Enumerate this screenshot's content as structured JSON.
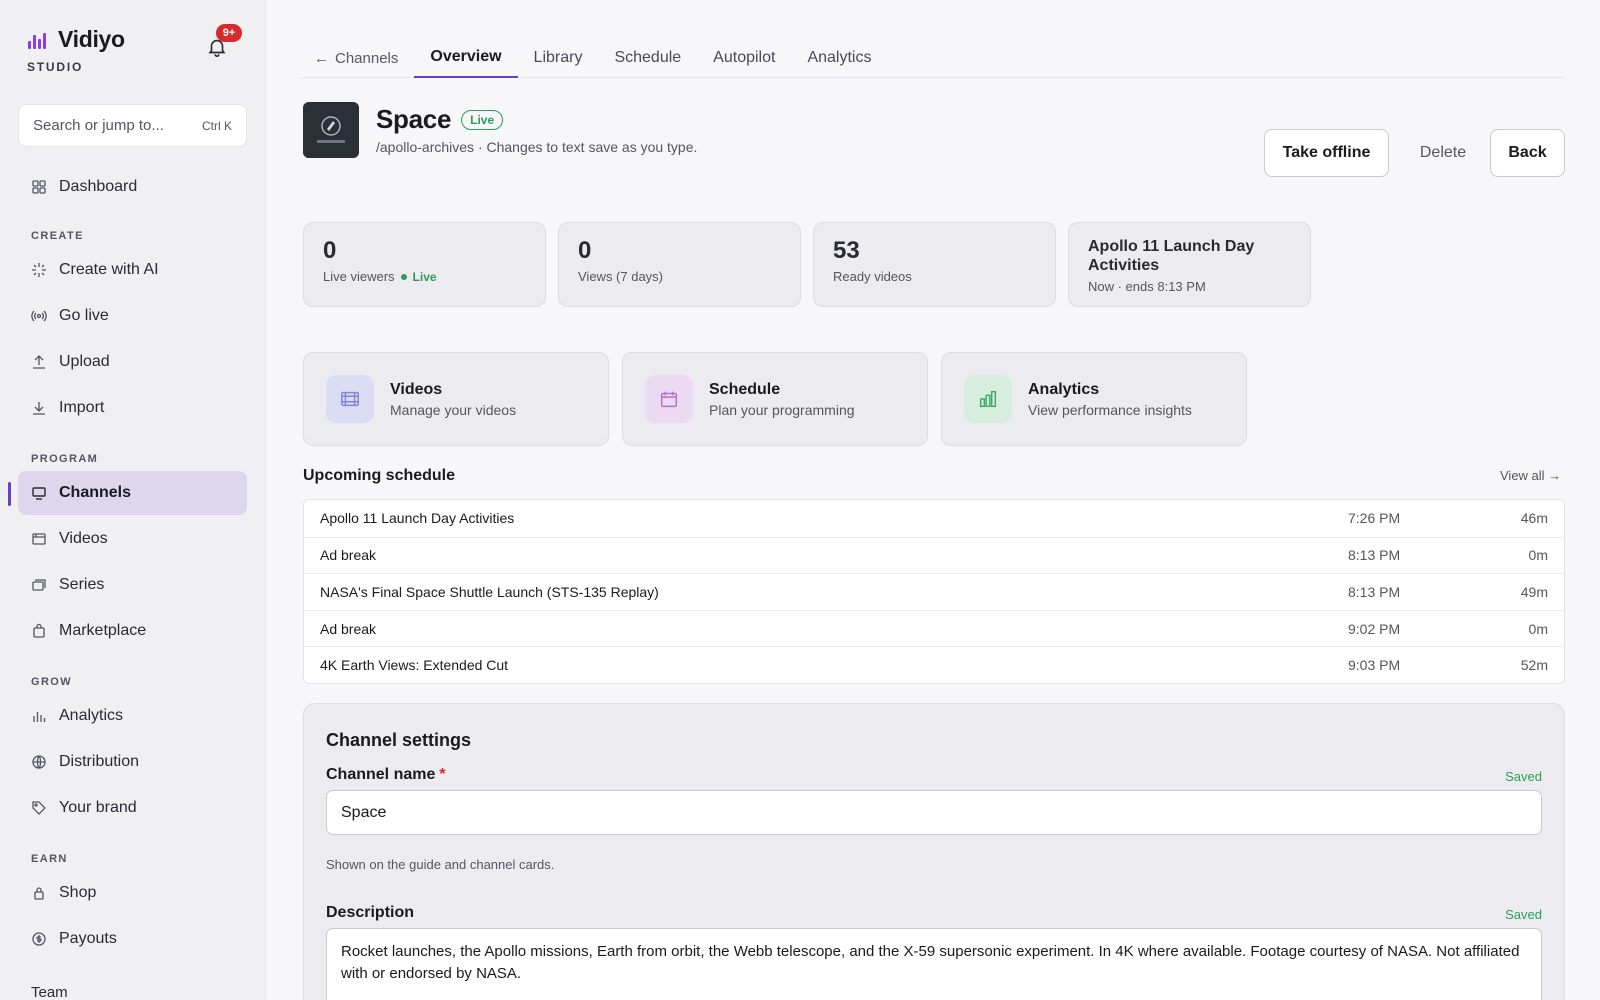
{
  "brand": {
    "name": "Vidiyo",
    "sub": "STUDIO",
    "notifications": "9+"
  },
  "search": {
    "placeholder": "Search or jump to...",
    "shortcut": "Ctrl K"
  },
  "sidebar": {
    "dashboard": "Dashboard",
    "sections": {
      "create": "CREATE",
      "program": "PROGRAM",
      "grow": "GROW",
      "earn": "EARN"
    },
    "create": [
      "Create with AI",
      "Go live",
      "Upload",
      "Import"
    ],
    "program": [
      "Channels",
      "Videos",
      "Series",
      "Marketplace"
    ],
    "grow": [
      "Analytics",
      "Distribution",
      "Your brand"
    ],
    "earn": [
      "Shop",
      "Payouts"
    ],
    "team": "Team"
  },
  "tabs": {
    "back": "Channels",
    "items": [
      "Overview",
      "Library",
      "Schedule",
      "Autopilot",
      "Analytics"
    ],
    "active": "Overview"
  },
  "channel": {
    "name": "Space",
    "status": "Live",
    "subtitle": "/apollo-archives · Changes to text save as you type."
  },
  "actions": {
    "take_offline": "Take offline",
    "delete": "Delete",
    "back": "Back"
  },
  "stats": {
    "live_viewers": {
      "value": "0",
      "label": "Live viewers",
      "badge": "Live"
    },
    "views": {
      "value": "0",
      "label": "Views (7 days)"
    },
    "ready": {
      "value": "53",
      "label": "Ready videos"
    },
    "now": {
      "title": "Apollo 11 Launch Day Activities",
      "label": "Now · ends 8:13 PM"
    }
  },
  "quick": [
    {
      "title": "Videos",
      "sub": "Manage your videos"
    },
    {
      "title": "Schedule",
      "sub": "Plan your programming"
    },
    {
      "title": "Analytics",
      "sub": "View performance insights"
    }
  ],
  "schedule": {
    "title": "Upcoming schedule",
    "view_all": "View all →",
    "rows": [
      {
        "title": "Apollo 11 Launch Day Activities",
        "time": "7:26 PM",
        "duration": "46m"
      },
      {
        "title": "Ad break",
        "time": "8:13 PM",
        "duration": "0m"
      },
      {
        "title": "NASA's Final Space Shuttle Launch (STS-135 Replay)",
        "time": "8:13 PM",
        "duration": "49m"
      },
      {
        "title": "Ad break",
        "time": "9:02 PM",
        "duration": "0m"
      },
      {
        "title": "4K Earth Views: Extended Cut",
        "time": "9:03 PM",
        "duration": "52m"
      }
    ]
  },
  "settings": {
    "title": "Channel settings",
    "name_label": "Channel name",
    "required": "*",
    "saved": "Saved",
    "name_value": "Space",
    "name_hint": "Shown on the guide and channel cards.",
    "desc_label": "Description",
    "desc_value": "Rocket launches, the Apollo missions, Earth from orbit, the Webb telescope, and the X-59 supersonic experiment. In 4K where available. Footage courtesy of NASA. Not affiliated with or endorsed by NASA."
  },
  "colors": {
    "accent": "#6b3cc4",
    "live": "#2f9b5b",
    "badge": "#d62b2b"
  }
}
